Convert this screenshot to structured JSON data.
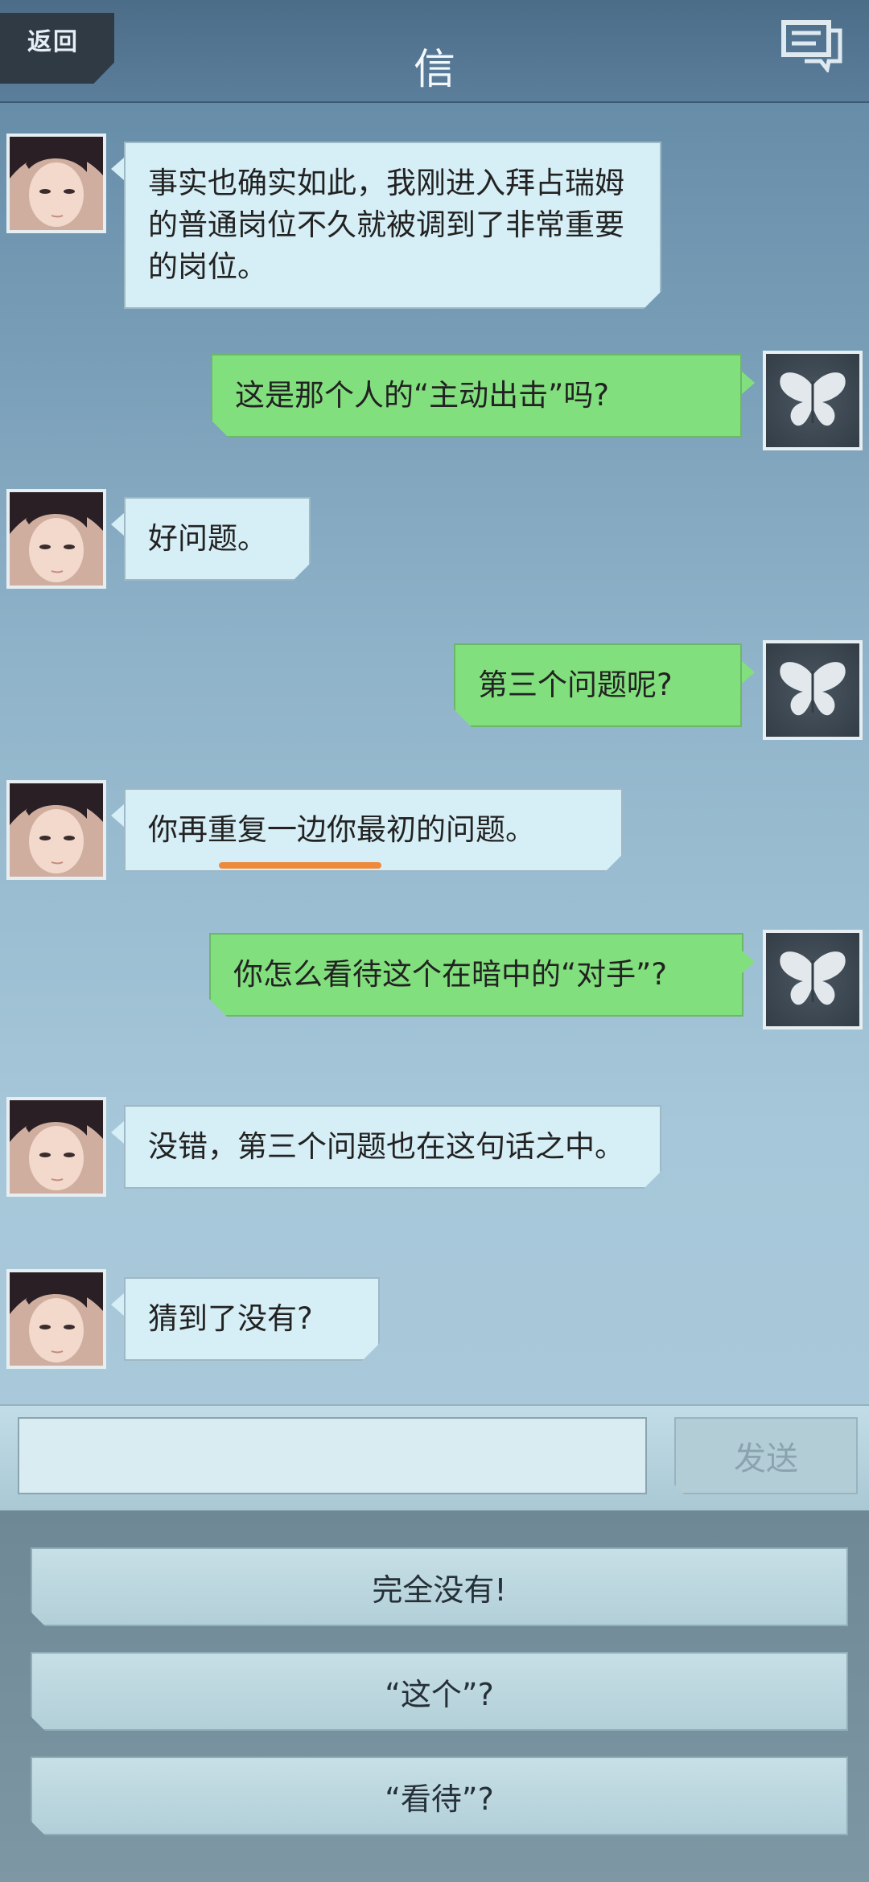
{
  "header": {
    "back_label": "返回",
    "title": "信",
    "chat_icon": "chat-bubbles-icon"
  },
  "messages": [
    {
      "side": "in",
      "text": "事实也确实如此，我刚进入拜占瑞姆的普通岗位不久就被调到了非常重要的岗位。"
    },
    {
      "side": "out",
      "text": "这是那个人的“主动出击”吗?"
    },
    {
      "side": "in",
      "text": "好问题。"
    },
    {
      "side": "out",
      "text": "第三个问题呢?"
    },
    {
      "side": "in",
      "text": "你再重复一边你最初的问题。"
    },
    {
      "side": "out",
      "text": "你怎么看待这个在暗中的“对手”?"
    },
    {
      "side": "in",
      "text": "没错，第三个问题也在这句话之中。"
    },
    {
      "side": "in",
      "text": "猜到了没有?"
    }
  ],
  "input": {
    "value": "",
    "send_label": "发送"
  },
  "options": [
    "完全没有!",
    "“这个”?",
    "“看待”?"
  ],
  "colors": {
    "incoming_bubble": "#d6eef5",
    "outgoing_bubble": "#82df7d",
    "underline_mark": "#ef8a3a"
  }
}
